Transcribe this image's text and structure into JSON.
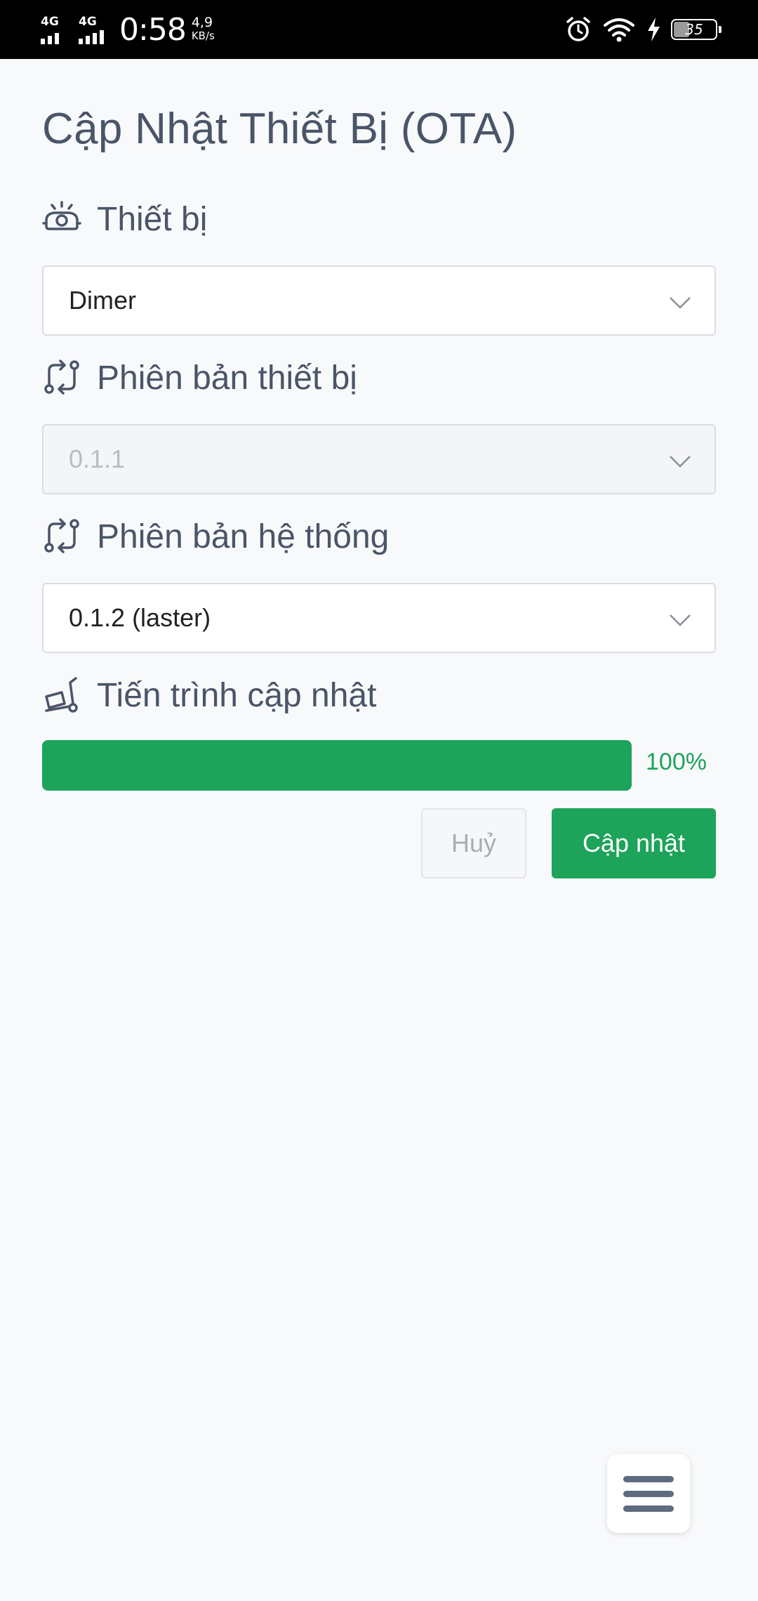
{
  "status_bar": {
    "network1": "4G",
    "network2": "4G",
    "time": "0:58",
    "speed_value": "4,9",
    "speed_unit": "KB/s",
    "battery": "35"
  },
  "page_title": "Cập Nhật Thiết Bị (OTA)",
  "device": {
    "label": "Thiết bị",
    "icon": "robot-vacuum-icon",
    "selected": "Dimer"
  },
  "device_version": {
    "label": "Phiên bản thiết bị",
    "icon": "swap-route-icon",
    "selected": "0.1.1",
    "disabled": true
  },
  "system_version": {
    "label": "Phiên bản hệ thống",
    "icon": "swap-route-icon",
    "selected": "0.1.2 (laster)"
  },
  "progress": {
    "label": "Tiến trình cập nhật",
    "icon": "dolly-icon",
    "value": 100,
    "text": "100%",
    "color": "#1da35a"
  },
  "actions": {
    "cancel": "Huỷ",
    "update": "Cập nhật"
  },
  "menu_button_icon": "hamburger-menu-icon"
}
